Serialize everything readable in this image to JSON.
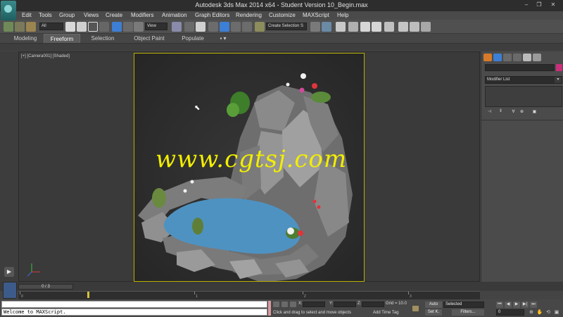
{
  "window": {
    "title": "Autodesk 3ds Max  2014 x64   -  Student Version    10_Begin.max",
    "minimize": "–",
    "maximize": "❐",
    "close": "✕"
  },
  "menu": [
    "Edit",
    "Tools",
    "Group",
    "Views",
    "Create",
    "Modifiers",
    "Animation",
    "Graph Editors",
    "Rendering",
    "Customize",
    "MAXScript",
    "Help"
  ],
  "toolbar": {
    "filter_value": "All",
    "ref_coord_value": "View",
    "selection_set_placeholder": "Create Selection S"
  },
  "ribbon": {
    "tabs": [
      "Modeling",
      "Freeform",
      "Selection",
      "Object Paint",
      "Populate"
    ],
    "active_tab": "Freeform",
    "options_glyph": "▪ ▾"
  },
  "viewport": {
    "label": "[+] [Camera001] [Shaded]",
    "watermark": "www.cgtsj.com",
    "cursor": "⬉",
    "safe_frame_color": "#b8b000",
    "water_color": "#4e92c2"
  },
  "command_panel": {
    "modifier_list": "Modifier List",
    "modifier_list_arrow": "▾",
    "object_color": "#c8307a",
    "stack_buttons": [
      "⊣",
      "‖",
      "∀",
      "⊗",
      "▣"
    ]
  },
  "time": {
    "slider_label": "0 / 3",
    "ticks": [
      "0",
      "1",
      "2",
      "3"
    ]
  },
  "status": {
    "maxscript_output": "Welcome to MAXScript.",
    "x_label": "X:",
    "y_label": "Y:",
    "z_label": "Z:",
    "grid": "Grid = 10.0",
    "prompt": "Click and drag to select and move objects",
    "add_time_tag": "Add Time Tag",
    "auto_key": "Auto",
    "set_key": "Set K.",
    "key_filter_value": "Selected",
    "filters": "Filters...",
    "frame_value": "0",
    "playback": [
      "⏮",
      "◀",
      "▶",
      "▶|",
      "⏭"
    ]
  }
}
